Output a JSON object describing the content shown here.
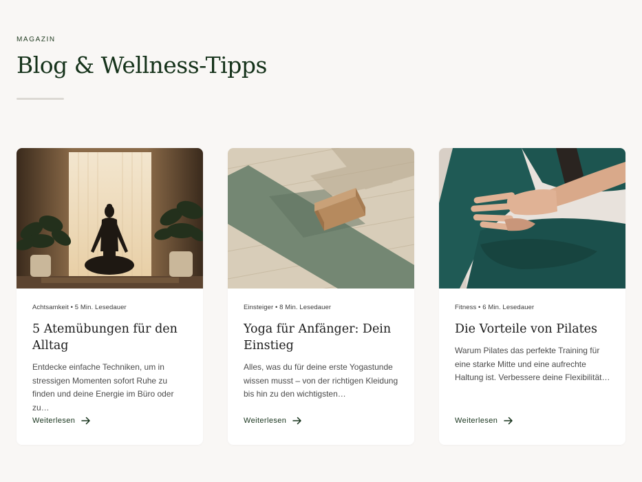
{
  "section": {
    "eyebrow": "MAGAZIN",
    "title": "Blog & Wellness-Tipps"
  },
  "colors": {
    "accent": "#15321a",
    "background": "#f9f7f5",
    "card": "#ffffff"
  },
  "cards": [
    {
      "image": "meditation-photo",
      "meta": "Achtsamkeit • 5 Min. Lesedauer",
      "title": "5 Atemübungen für den Alltag",
      "excerpt": "Entdecke einfache Techniken, um in stressigen Momenten sofort Ruhe zu finden und deine Energie im Büro oder zu…",
      "link": "Weiterlesen"
    },
    {
      "image": "yoga-mat-photo",
      "meta": "Einsteiger • 8 Min. Lesedauer",
      "title": "Yoga für Anfänger: Dein Einstieg",
      "excerpt": "Alles, was du für deine erste Yogastunde wissen musst – von der richtigen Kleidung bis hin zu den wichtigsten…",
      "link": "Weiterlesen"
    },
    {
      "image": "pilates-photo",
      "meta": "Fitness • 6 Min. Lesedauer",
      "title": "Die Vorteile von Pilates",
      "excerpt": "Warum Pilates das perfekte Training für eine starke Mitte und eine aufrechte Haltung ist. Verbessere deine Flexibilität…",
      "link": "Weiterlesen"
    }
  ],
  "icons": {
    "link_arrow": "arrow-right-icon"
  }
}
